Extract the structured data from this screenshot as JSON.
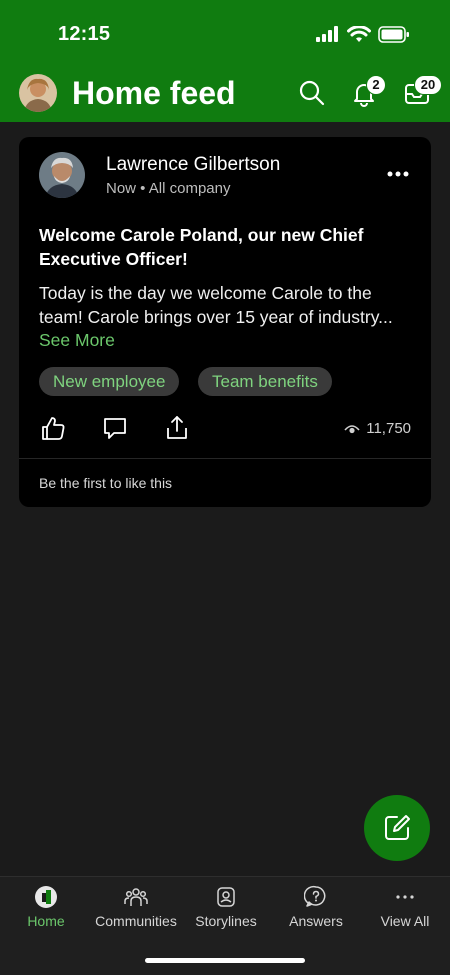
{
  "status_bar": {
    "time": "12:15"
  },
  "header": {
    "title": "Home feed",
    "notifications_count": "2",
    "inbox_count": "20",
    "background_color": "#107c10"
  },
  "post": {
    "author": "Lawrence Gilbertson",
    "meta": "Now • All company",
    "title": "Welcome Carole Poland, our new Chief Executive Officer!",
    "body": "Today is the day we welcome Carole to the team! Carole brings over 15 year of industry...",
    "see_more": "See More",
    "tags": [
      "New employee",
      "Team benefits"
    ],
    "views": "11,750",
    "like_note": "Be the first to like this"
  },
  "tabs": [
    {
      "label": "Home",
      "icon": "home-network-icon",
      "active": true
    },
    {
      "label": "Communities",
      "icon": "people-group-icon",
      "active": false
    },
    {
      "label": "Storylines",
      "icon": "storyline-icon",
      "active": false
    },
    {
      "label": "Answers",
      "icon": "question-chat-icon",
      "active": false
    },
    {
      "label": "View All",
      "icon": "ellipsis-icon",
      "active": false
    }
  ],
  "colors": {
    "accent": "#107c10",
    "link": "#6bc76b",
    "card": "#000000",
    "background": "#1b1b1b"
  }
}
